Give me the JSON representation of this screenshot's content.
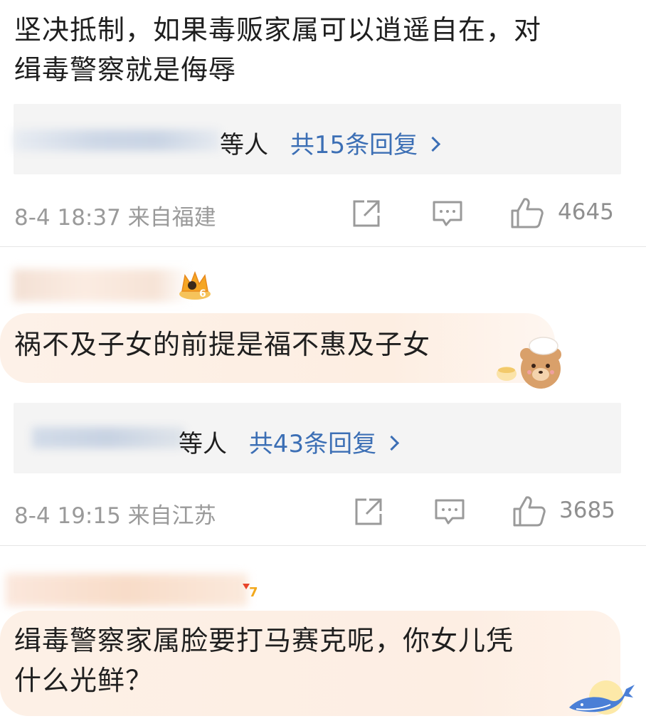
{
  "comments": [
    {
      "text_line1": "坚决抵制，如果毒贩家属可以逍遥自在，对",
      "text_line2": "缉毒警察就是侮辱",
      "reply_suffix": "等人",
      "reply_count": "共15条回复",
      "meta": "8-4 18:37 来自福建",
      "likes": "4645"
    },
    {
      "badge_level": "6",
      "text": "祸不及子女的前提是福不惠及子女",
      "reply_suffix": "等人",
      "reply_count": "共43条回复",
      "meta": "8-4 19:15 来自江苏",
      "likes": "3685"
    },
    {
      "badge_level": "7",
      "text_line1": "缉毒警察家属脸要打马赛克呢，你女儿凭",
      "text_line2": "什么光鲜？"
    }
  ],
  "colors": {
    "link": "#3c6fb5",
    "meta": "#9a9a9a",
    "reply_bg": "#f4f4f4",
    "highlight": "#fdf0e6"
  }
}
